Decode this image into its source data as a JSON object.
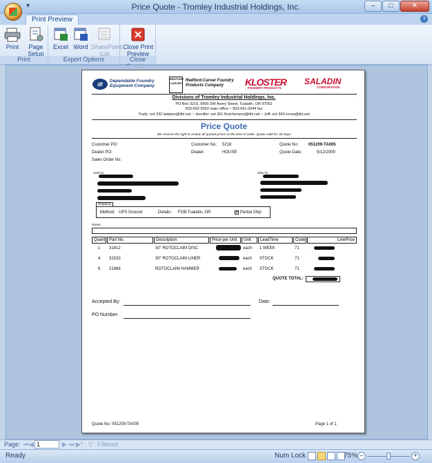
{
  "window": {
    "title": "Price Quote - Tromley Industrial Holdings, Inc.",
    "qat": "▾",
    "min": "–",
    "max": "□",
    "close": "✕"
  },
  "ribbon": {
    "tab": "Print Preview",
    "groups": [
      {
        "label": "Print",
        "buttons": [
          "Print",
          "Page Setup"
        ]
      },
      {
        "label": "Export Options",
        "buttons": [
          "Excel",
          "Word",
          "SharePoint List"
        ]
      },
      {
        "label": "Close Preview",
        "buttons": [
          "Close Print Preview"
        ]
      }
    ]
  },
  "report": {
    "logos": {
      "dependable": "Dependable Foundry Equipment Company",
      "redford_mark": "REDFORD CARVER",
      "redford": "Redford-Carver Foundry Products Company",
      "kloster": "KLOSTER",
      "kloster_sub": "FOUNDRY PRODUCTS",
      "saladin": "SALADIN",
      "saladin_sub": "CORPORATION"
    },
    "division_title": "Divisions of Tromley Industrial Holdings, Inc.",
    "address": "PO Box 3210, 9995 SW Avery Street, Tualatin, OR 97062",
    "phone": "503-692-5552 main office ~ 503-691-2544 fax",
    "contacts": "Trudy: ext 332 tadams@tihi.net ~ Jennifer: ext 361 lhutchenson@tihi.net ~ Jeff: ext 363 icrow@tihi.net",
    "title": "Price Quote",
    "disclaimer": "We reserve the right to review all quoted prices at the time of order. Quote valid for 30 Days",
    "customer_po_label": "Customer PO:",
    "dealer_po_label": "Dealer PO:",
    "sales_order_label": "Sales Order No:",
    "customer_no_label": "Customer No:",
    "customer_no": "5218",
    "dealer_label": "Dealer:",
    "dealer": "HOUSE",
    "quote_no_label": "Quote No:",
    "quote_no": "051209-TA005",
    "quote_date_label": "Quote Date:",
    "quote_date": "5/12/2009",
    "sold_to_label": "Sold To:",
    "ship_to_label": "Ship To:",
    "shipping_label": "Shipping",
    "method_label": "Method:",
    "method": "UPS Ground",
    "details_label": "Details:",
    "details": "FOB Tualatin, OR",
    "partial_ship": "Partial Ship",
    "notes_label": "Notes:",
    "columns": [
      "Quant",
      "Part No.",
      "Description",
      "Price per Unit",
      "Unit",
      "LeadTime",
      "Code",
      "LinePrice"
    ],
    "rows": [
      {
        "quant": "1",
        "part": "31812",
        "desc": "30\" ROTOCLAIM DISC",
        "unit": "each",
        "lead": "1 WEEK",
        "code": "71"
      },
      {
        "quant": "4",
        "part": "31533",
        "desc": "30\" ROTOCLAIM LINER",
        "unit": "each",
        "lead": "STOCK",
        "code": "71"
      },
      {
        "quant": "6",
        "part": "21866",
        "desc": "ROTOCLAIM HAMMER",
        "unit": "each",
        "lead": "STOCK",
        "code": "71"
      }
    ],
    "quote_total_label": "QUOTE TOTAL:",
    "accepted_by_label": "Accepted By:",
    "date_label": "Date:",
    "po_number_label": "PO Number:",
    "footer_quote": "Quote No: 051209-TA005",
    "footer_page": "Page 1 of 1"
  },
  "nav": {
    "page_label": "Page:",
    "page_value": "1",
    "filter": "Filtered"
  },
  "status": {
    "ready": "Ready",
    "numlock": "Num Lock",
    "zoom": "75%"
  }
}
